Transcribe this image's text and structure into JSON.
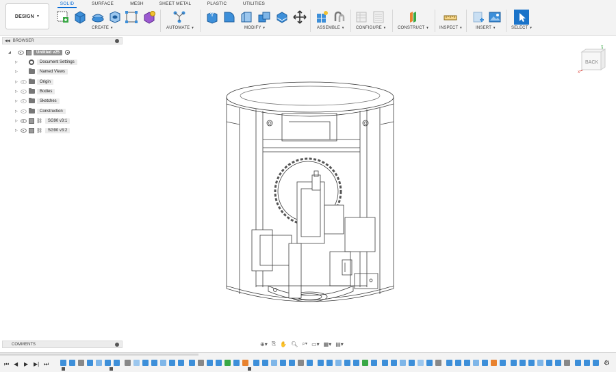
{
  "workspace": {
    "label": "DESIGN"
  },
  "tabs": [
    {
      "label": "SOLID",
      "active": true
    },
    {
      "label": "SURFACE",
      "active": false
    },
    {
      "label": "MESH",
      "active": false
    },
    {
      "label": "SHEET METAL",
      "active": false
    },
    {
      "label": "PLASTIC",
      "active": false
    },
    {
      "label": "UTILITIES",
      "active": false
    }
  ],
  "groups": {
    "create": "CREATE",
    "automate": "AUTOMATE",
    "modify": "MODIFY",
    "assemble": "ASSEMBLE",
    "configure": "CONFIGURE",
    "construct": "CONSTRUCT",
    "inspect": "INSPECT",
    "insert": "INSERT",
    "select": "SELECT"
  },
  "browser": {
    "title": "BROWSER",
    "root": "Untitled v25",
    "items": [
      {
        "label": "Document Settings",
        "icon": "gear-icon"
      },
      {
        "label": "Named Views",
        "icon": "folder-icon"
      },
      {
        "label": "Origin",
        "icon": "folder-icon"
      },
      {
        "label": "Bodies",
        "icon": "folder-icon"
      },
      {
        "label": "Sketches",
        "icon": "folder-icon"
      },
      {
        "label": "Construction",
        "icon": "folder-icon"
      },
      {
        "label": "SG90 v3:1",
        "icon": "component-icon"
      },
      {
        "label": "SG90 v3:2",
        "icon": "component-icon"
      }
    ]
  },
  "comments": {
    "title": "COMMENTS"
  },
  "viewcube": {
    "face": "BACK",
    "axis_x": "X",
    "axis_y": "Y"
  },
  "colors": {
    "accent": "#0a6cd6",
    "feature_blue": "#3d8fd9",
    "construct_orange": "#e8822e"
  }
}
